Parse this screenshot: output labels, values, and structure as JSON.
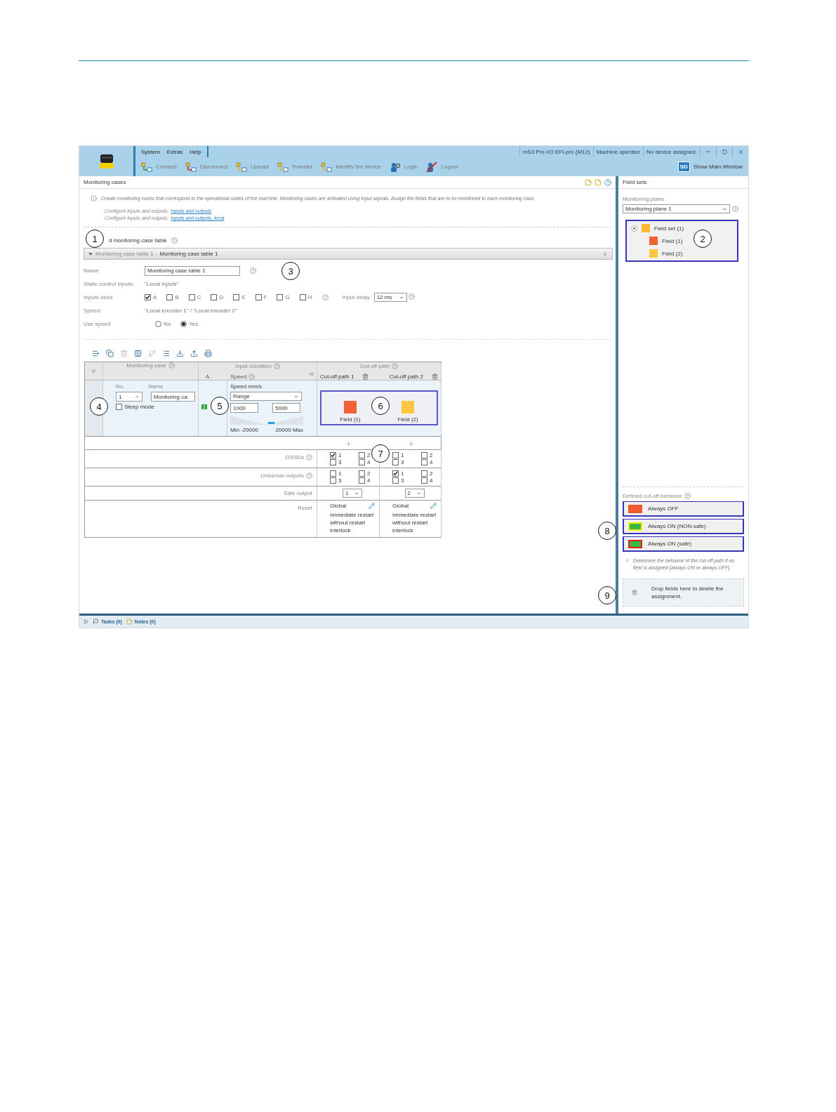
{
  "header": {
    "menu": [
      "System",
      "Extras",
      "Help"
    ],
    "status": [
      "mS3 Pro I/O EFI-pro (M12)",
      "Machine operator",
      "No device assigned."
    ],
    "toolbar": [
      {
        "label": "Connect",
        "kind": "connect"
      },
      {
        "label": "Disconnect",
        "kind": "disconnect"
      },
      {
        "label": "Upload",
        "kind": "upload"
      },
      {
        "label": "Transfer",
        "kind": "transfer"
      },
      {
        "label": "Identify the device",
        "kind": "identify"
      },
      {
        "label": "Login",
        "kind": "login"
      },
      {
        "label": "Logout",
        "kind": "logout"
      }
    ],
    "show_main": {
      "badge": "SD",
      "label": "Show Main Window"
    }
  },
  "main": {
    "title": "Monitoring cases",
    "info": "Create monitoring cases that correspond to the operational states of the machine. Monitoring cases are activated using input signals. Assign the fields that are to be monitored to each monitoring case.",
    "links": [
      {
        "prefix": "Configure inputs and outputs:",
        "link": "Inputs and outputs"
      },
      {
        "prefix": "Configure inputs and outputs:",
        "link": "Inputs and outputs, local"
      }
    ],
    "add_label": "d monitoring case table",
    "section": {
      "expanded": true,
      "prefix": "Monitoring case table 1 - ",
      "title": "Monitoring case table 1"
    },
    "form": {
      "name_label": "Name",
      "name_value": "Monitoring case table 1",
      "static_label": "Static control inputs:",
      "static_value": "\"Local inputs\"",
      "inputs_label": "Inputs used",
      "inputs": [
        {
          "label": "A",
          "checked": true
        },
        {
          "label": "B",
          "checked": false
        },
        {
          "label": "C",
          "checked": false
        },
        {
          "label": "D",
          "checked": false
        },
        {
          "label": "E",
          "checked": false
        },
        {
          "label": "F",
          "checked": false
        },
        {
          "label": "G",
          "checked": false
        },
        {
          "label": "H",
          "checked": false
        }
      ],
      "delay_label": "Input delay",
      "delay_value": "12 ms",
      "speed_label": "Speed:",
      "speed_value": "\"Local encoder 1\"  /  \"Local encoder 2\"",
      "use_speed_label": "Use speed",
      "use_speed": [
        {
          "label": "No",
          "selected": false
        },
        {
          "label": "Yes",
          "selected": true
        }
      ]
    },
    "grid": {
      "case_header": "Monitoring case",
      "input_header": "Input condition",
      "input_a": "A",
      "speed_header": "Speed",
      "cutoff_header": "Cut-off path",
      "paths": [
        "Cut-off path 1",
        "Cut-off path 2"
      ],
      "row": {
        "no_label": "No.",
        "no_value": "1",
        "name_label": "Name",
        "name_value": "Monitoring ca:",
        "sleep_label": "Sleep mode",
        "sleep": false,
        "input_a": "1",
        "speed_label": "Speed mm/s",
        "speed_mode": "Range",
        "speed_min": "1000",
        "speed_max": "5000",
        "range_min": "Min -20000",
        "range_max": "20000 Max",
        "fields": [
          {
            "label": "Field (1)",
            "color": "#f26236"
          },
          {
            "label": "Field (2)",
            "color": "#fdc63f"
          }
        ]
      },
      "outputs": [
        {
          "label": "OSSDs",
          "paths": [
            [
              {
                "label": "1",
                "checked": true
              },
              {
                "label": "2",
                "checked": false
              },
              {
                "label": "3",
                "checked": false
              },
              {
                "label": "4",
                "checked": false
              }
            ],
            [
              {
                "label": "1",
                "checked": false
              },
              {
                "label": "2",
                "checked": false
              },
              {
                "label": "3",
                "checked": false
              },
              {
                "label": "4",
                "checked": false
              }
            ]
          ]
        },
        {
          "label": "Universal outputs",
          "paths": [
            [
              {
                "label": "1",
                "checked": false
              },
              {
                "label": "2",
                "checked": false
              },
              {
                "label": "3",
                "checked": false
              },
              {
                "label": "4",
                "checked": false
              }
            ],
            [
              {
                "label": "1",
                "checked": true
              },
              {
                "label": "2",
                "checked": false
              },
              {
                "label": "3",
                "checked": false
              },
              {
                "label": "4",
                "checked": false
              }
            ]
          ]
        }
      ],
      "safe_label": "Safe output",
      "safe": [
        "1",
        "2"
      ],
      "reset_label": "Reset",
      "reset": [
        {
          "scope": "Global",
          "text": "Immediate restart without restart interlock"
        },
        {
          "scope": "Global",
          "text": "Immediate restart without restart interlock"
        }
      ]
    }
  },
  "side": {
    "title": "Field sets",
    "plane_label": "Monitoring plane",
    "plane_value": "Monitoring plane 1",
    "tree": {
      "label": "Field set (1)",
      "expanded": true,
      "children": [
        {
          "label": "Field (1)",
          "color": "#f26236"
        },
        {
          "label": "Field (2)",
          "color": "#fdc63f"
        }
      ]
    },
    "behavior_label": "Defined cut-off behavior",
    "behaviors": [
      {
        "label": "Always OFF",
        "kind": "off"
      },
      {
        "label": "Always ON (NON-safe)",
        "kind": "non_safe"
      },
      {
        "label": "Always ON (safe)",
        "kind": "safe"
      }
    ],
    "behavior_info": "Determine the behavior of the cut-off path if no field is assigned (always ON or always OFF).",
    "drop": "Drop fields here to delete the assignment."
  },
  "status_bar": [
    {
      "label": "Tasks (0)",
      "kind": "tasks"
    },
    {
      "label": "Notes (0)",
      "kind": "notes"
    }
  ],
  "callouts": [
    "1",
    "2",
    "3",
    "4",
    "5",
    "6",
    "7",
    "8",
    "9"
  ]
}
